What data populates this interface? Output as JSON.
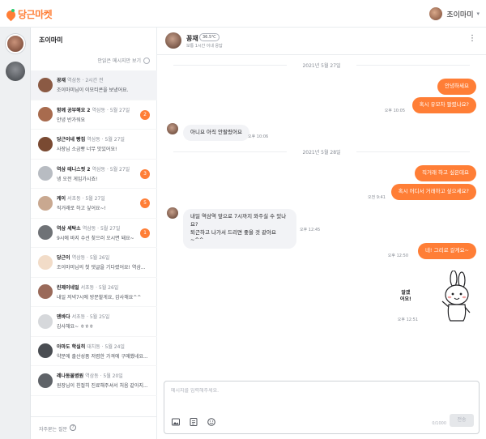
{
  "app": {
    "logo_text": "당근마켓"
  },
  "user": {
    "name": "조이마미"
  },
  "list": {
    "title": "조이마미",
    "unread_toggle": "안읽은 메시지만 보기",
    "footer_help": "자주묻는 질문",
    "items": [
      {
        "name": "꽁재",
        "meta": "역삼동 · 2시간 전",
        "message": "조이마미님이 이모티콘을 보냈어요.",
        "badge": "",
        "active": true,
        "avatar_color": "#8b5a44"
      },
      {
        "name": "함께 공부해요 2",
        "meta": "역삼동 · 5월 27일",
        "message": "안녕 반가워요",
        "badge": "2",
        "active": false,
        "avatar_color": "#a86b4e"
      },
      {
        "name": "당근이네 빵집",
        "meta": "역삼동 · 5월 27일",
        "message": "사장님 소금빵 너무 맛있어요!",
        "badge": "",
        "active": false,
        "avatar_color": "#7a4a32"
      },
      {
        "name": "역삼 테니스핏 2",
        "meta": "역삼동 · 5월 27일",
        "message": "넹 오전 게임가시죠!",
        "badge": "3",
        "active": false,
        "avatar_color": "#b8bcc2"
      },
      {
        "name": "케이",
        "meta": "서초동 · 5월 27일",
        "message": "직거래로 하고 싶어요~!",
        "badge": "5",
        "active": false,
        "avatar_color": "#c9a890"
      },
      {
        "name": "역삼 세탁소",
        "meta": "역삼동 · 5월 27일",
        "message": "9시에 바지 수선 찾으러 오시면 돼요~",
        "badge": "1",
        "active": false,
        "avatar_color": "#6f7276"
      },
      {
        "name": "당근이",
        "meta": "역삼동 · 5월 26일",
        "message": "조이마미님의 첫 댓글을 기다렸어요! 역삼...",
        "badge": "",
        "active": false,
        "avatar_color": "#f2dcc8"
      },
      {
        "name": "린제이네일",
        "meta": "서초동 · 5월 26일",
        "message": "내일 저녁7시에 방문할게요, 감사해요^^",
        "badge": "",
        "active": false,
        "avatar_color": "#9a6a5a"
      },
      {
        "name": "덴바다",
        "meta": "서초동 · 5월 25일",
        "message": "감사해요~ ㅎㅎㅎ",
        "badge": "",
        "active": false,
        "avatar_color": "#d6d8db"
      },
      {
        "name": "아마도 학실히",
        "meta": "대치동 · 5월 24일",
        "message": "약분에 출산성품 저렴한 가격에 구매했네요...",
        "badge": "",
        "active": false,
        "avatar_color": "#4a4d52"
      },
      {
        "name": "레나동물병원",
        "meta": "역삼동 · 5월 20일",
        "message": "원장님이 친절히 진료해주셔서 처음 같아지...",
        "badge": "",
        "active": false,
        "avatar_color": "#5f6368"
      }
    ]
  },
  "conversation": {
    "partner_name": "꽁재",
    "partner_temp": "36.5℃",
    "partner_sub": "보통 1시간 이내 응답",
    "date1": "2021년 5월 27일",
    "date2": "2021년 5월 28일",
    "messages": [
      {
        "dir": "out",
        "text": "안녕하세요",
        "time": ""
      },
      {
        "dir": "out",
        "text": "혹시 유모차 팔렸나요?",
        "time": "오후 10:05"
      },
      {
        "dir": "in",
        "text": "아니요 아직 안팔렸어요",
        "time": "오후 10:06"
      },
      {
        "dir": "out",
        "text": "직거래 하고 싶은데요",
        "time": ""
      },
      {
        "dir": "out",
        "text": "혹시 어디서 거래하고 싶으세요?",
        "time": "오전 9:41"
      },
      {
        "dir": "in",
        "text": "내일 역삼역 앞으로 7시까지 와주실 수 있나요?",
        "text2": "퇴근하고 나가서 드리면 좋을 것 같아요~^^",
        "time": "오후 12:45"
      },
      {
        "dir": "out",
        "text": "네! 그리로 갈게요~",
        "time": "오후 12:50"
      }
    ],
    "sticker_text": "알겠\n어요!",
    "sticker_time": "오후 12:51",
    "composer_placeholder": "메시지를 입력해주세요.",
    "counter": "0/1000",
    "send_label": "전송"
  },
  "colors": {
    "accent": "#ff7e36",
    "bubble_in": "#f2f3f6"
  }
}
